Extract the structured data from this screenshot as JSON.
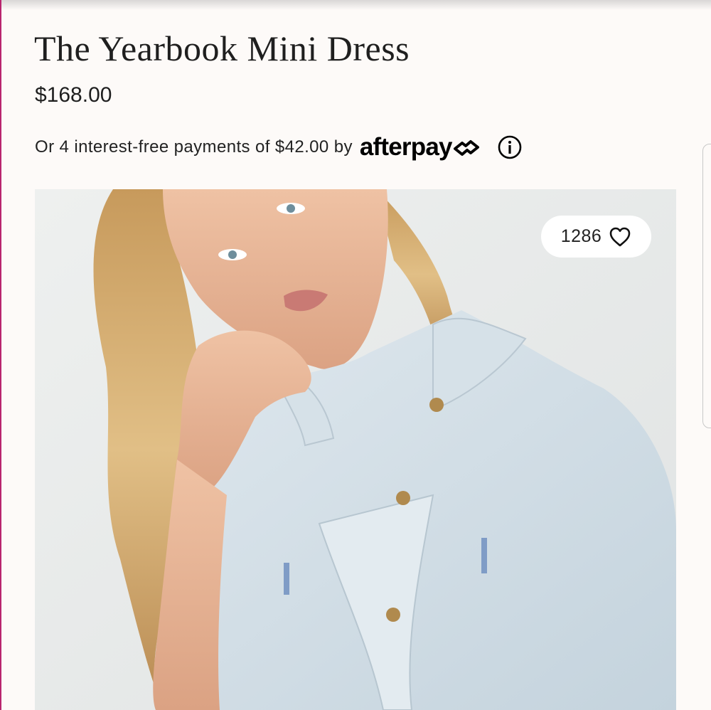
{
  "product": {
    "title": "The Yearbook Mini Dress",
    "price": "$168.00"
  },
  "afterpay": {
    "text": "Or 4 interest-free payments of $42.00 by",
    "brand": "afterpay"
  },
  "likes": {
    "count": "1286"
  },
  "icons": {
    "info": "info-icon",
    "heart": "heart-icon",
    "afterpay_mark": "afterpay-arrows-icon"
  },
  "colors": {
    "background": "#fdfaf8",
    "text": "#1f1f1f",
    "edge_accent": "#b9246e"
  }
}
